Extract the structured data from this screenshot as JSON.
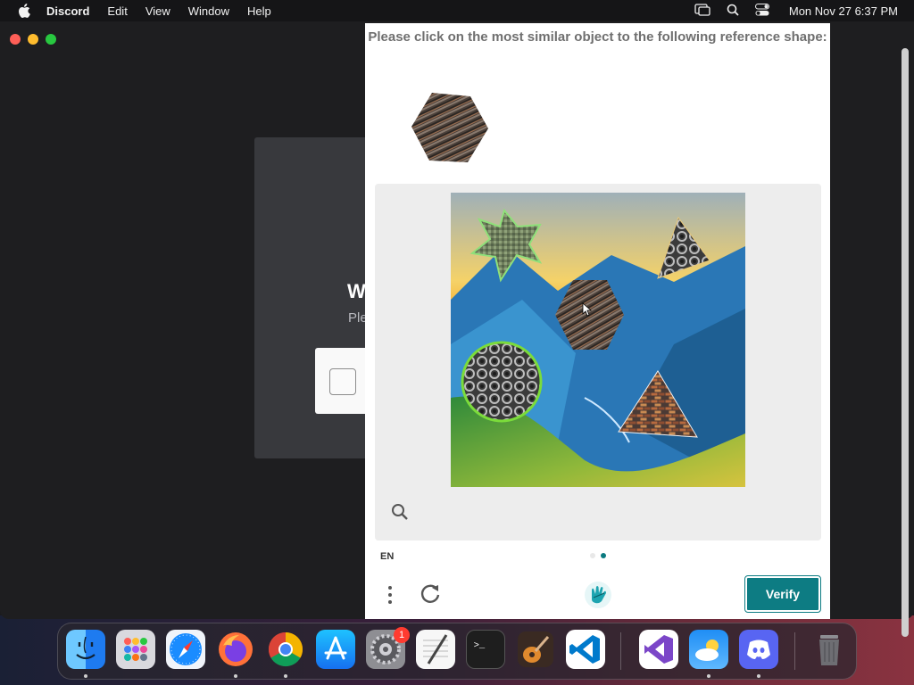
{
  "menubar": {
    "app_name": "Discord",
    "items": [
      "Edit",
      "View",
      "Window",
      "Help"
    ],
    "clock": "Mon Nov 27  6:37 PM",
    "icons": [
      "apple-icon",
      "screen-mirroring-icon",
      "spotlight-search-icon",
      "control-center-icon"
    ]
  },
  "modal": {
    "heading_fragment": "W",
    "subtext_fragment": "Ple"
  },
  "captcha": {
    "prompt": "Please click on the most similar object to the following reference shape:",
    "reference_shape": "hexagon",
    "image_objects": [
      "star",
      "triangle",
      "hexagon",
      "circle",
      "triangle"
    ],
    "language": "EN",
    "pagination": {
      "current": 2,
      "total": 2
    },
    "verify_label": "Verify",
    "accent_color": "#0d7c83"
  },
  "dock": {
    "apps": [
      "Finder",
      "Launchpad",
      "Safari",
      "Firefox",
      "Chrome",
      "App Store",
      "System Settings",
      "TextEdit",
      "Terminal",
      "GarageBand",
      "Visual Studio Code",
      "Visual Studio",
      "Weather",
      "Discord",
      "Trash"
    ],
    "system_settings_badge": "1"
  }
}
